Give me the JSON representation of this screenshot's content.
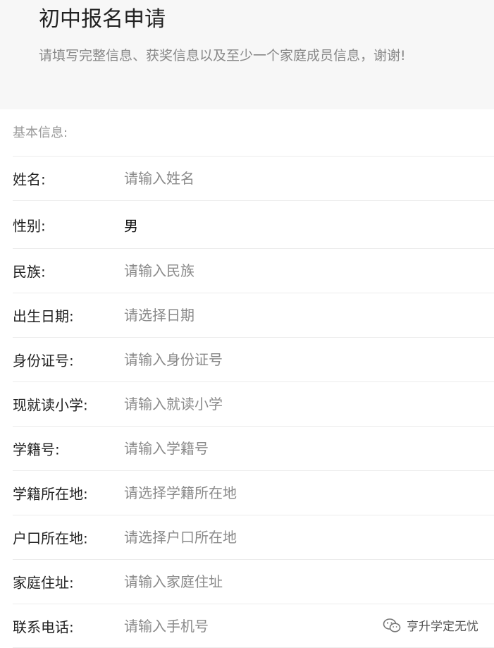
{
  "header": {
    "title": "初中报名申请",
    "subtitle": "请填写完整信息、获奖信息以及至少一个家庭成员信息，谢谢!"
  },
  "section": {
    "label": "基本信息:"
  },
  "fields": {
    "name": {
      "label": "姓名:",
      "placeholder": "请输入姓名"
    },
    "gender": {
      "label": "性别:",
      "value": "男"
    },
    "ethnicity": {
      "label": "民族:",
      "placeholder": "请输入民族"
    },
    "birthdate": {
      "label": "出生日期:",
      "placeholder": "请选择日期"
    },
    "id_number": {
      "label": "身份证号:",
      "placeholder": "请输入身份证号"
    },
    "primary_school": {
      "label": "现就读小学:",
      "placeholder": "请输入就读小学"
    },
    "student_number": {
      "label": "学籍号:",
      "placeholder": "请输入学籍号"
    },
    "student_registry_location": {
      "label": "学籍所在地:",
      "placeholder": "请选择学籍所在地"
    },
    "household_location": {
      "label": "户口所在地:",
      "placeholder": "请选择户口所在地"
    },
    "home_address": {
      "label": "家庭住址:",
      "placeholder": "请输入家庭住址"
    },
    "phone": {
      "label": "联系电话:",
      "placeholder": "请输入手机号"
    }
  },
  "watermark": {
    "text": "亨升学定无忧",
    "icon": "wechat-icon"
  }
}
